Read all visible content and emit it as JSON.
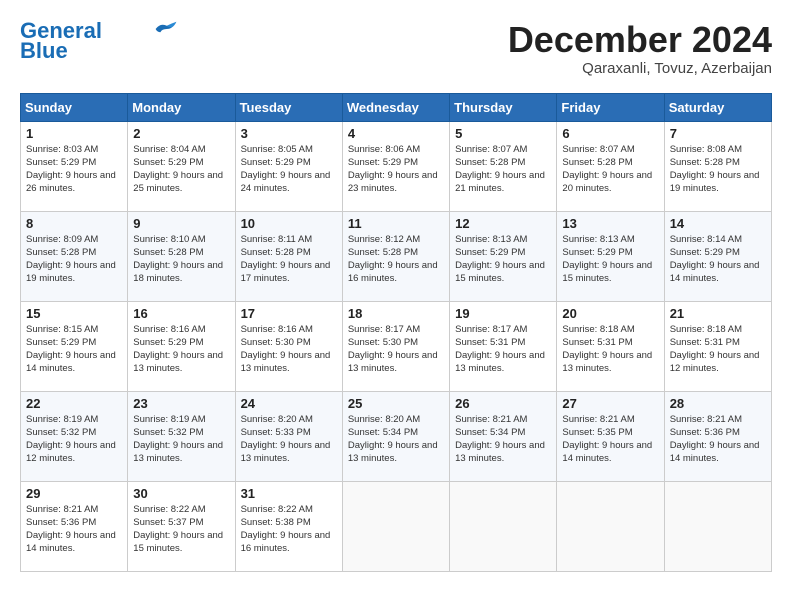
{
  "header": {
    "logo_line1": "General",
    "logo_line2": "Blue",
    "title": "December 2024",
    "subtitle": "Qaraxanli, Tovuz, Azerbaijan"
  },
  "calendar": {
    "headers": [
      "Sunday",
      "Monday",
      "Tuesday",
      "Wednesday",
      "Thursday",
      "Friday",
      "Saturday"
    ],
    "weeks": [
      [
        null,
        {
          "day": 2,
          "sunrise": "8:04 AM",
          "sunset": "5:29 PM",
          "daylight": "9 hours and 25 minutes."
        },
        {
          "day": 3,
          "sunrise": "8:05 AM",
          "sunset": "5:29 PM",
          "daylight": "9 hours and 24 minutes."
        },
        {
          "day": 4,
          "sunrise": "8:06 AM",
          "sunset": "5:29 PM",
          "daylight": "9 hours and 23 minutes."
        },
        {
          "day": 5,
          "sunrise": "8:07 AM",
          "sunset": "5:28 PM",
          "daylight": "9 hours and 21 minutes."
        },
        {
          "day": 6,
          "sunrise": "8:07 AM",
          "sunset": "5:28 PM",
          "daylight": "9 hours and 20 minutes."
        },
        {
          "day": 7,
          "sunrise": "8:08 AM",
          "sunset": "5:28 PM",
          "daylight": "9 hours and 19 minutes."
        }
      ],
      [
        {
          "day": 8,
          "sunrise": "8:09 AM",
          "sunset": "5:28 PM",
          "daylight": "9 hours and 19 minutes."
        },
        {
          "day": 9,
          "sunrise": "8:10 AM",
          "sunset": "5:28 PM",
          "daylight": "9 hours and 18 minutes."
        },
        {
          "day": 10,
          "sunrise": "8:11 AM",
          "sunset": "5:28 PM",
          "daylight": "9 hours and 17 minutes."
        },
        {
          "day": 11,
          "sunrise": "8:12 AM",
          "sunset": "5:28 PM",
          "daylight": "9 hours and 16 minutes."
        },
        {
          "day": 12,
          "sunrise": "8:13 AM",
          "sunset": "5:29 PM",
          "daylight": "9 hours and 15 minutes."
        },
        {
          "day": 13,
          "sunrise": "8:13 AM",
          "sunset": "5:29 PM",
          "daylight": "9 hours and 15 minutes."
        },
        {
          "day": 14,
          "sunrise": "8:14 AM",
          "sunset": "5:29 PM",
          "daylight": "9 hours and 14 minutes."
        }
      ],
      [
        {
          "day": 15,
          "sunrise": "8:15 AM",
          "sunset": "5:29 PM",
          "daylight": "9 hours and 14 minutes."
        },
        {
          "day": 16,
          "sunrise": "8:16 AM",
          "sunset": "5:29 PM",
          "daylight": "9 hours and 13 minutes."
        },
        {
          "day": 17,
          "sunrise": "8:16 AM",
          "sunset": "5:30 PM",
          "daylight": "9 hours and 13 minutes."
        },
        {
          "day": 18,
          "sunrise": "8:17 AM",
          "sunset": "5:30 PM",
          "daylight": "9 hours and 13 minutes."
        },
        {
          "day": 19,
          "sunrise": "8:17 AM",
          "sunset": "5:31 PM",
          "daylight": "9 hours and 13 minutes."
        },
        {
          "day": 20,
          "sunrise": "8:18 AM",
          "sunset": "5:31 PM",
          "daylight": "9 hours and 13 minutes."
        },
        {
          "day": 21,
          "sunrise": "8:18 AM",
          "sunset": "5:31 PM",
          "daylight": "9 hours and 12 minutes."
        }
      ],
      [
        {
          "day": 22,
          "sunrise": "8:19 AM",
          "sunset": "5:32 PM",
          "daylight": "9 hours and 12 minutes."
        },
        {
          "day": 23,
          "sunrise": "8:19 AM",
          "sunset": "5:32 PM",
          "daylight": "9 hours and 13 minutes."
        },
        {
          "day": 24,
          "sunrise": "8:20 AM",
          "sunset": "5:33 PM",
          "daylight": "9 hours and 13 minutes."
        },
        {
          "day": 25,
          "sunrise": "8:20 AM",
          "sunset": "5:34 PM",
          "daylight": "9 hours and 13 minutes."
        },
        {
          "day": 26,
          "sunrise": "8:21 AM",
          "sunset": "5:34 PM",
          "daylight": "9 hours and 13 minutes."
        },
        {
          "day": 27,
          "sunrise": "8:21 AM",
          "sunset": "5:35 PM",
          "daylight": "9 hours and 14 minutes."
        },
        {
          "day": 28,
          "sunrise": "8:21 AM",
          "sunset": "5:36 PM",
          "daylight": "9 hours and 14 minutes."
        }
      ],
      [
        {
          "day": 29,
          "sunrise": "8:21 AM",
          "sunset": "5:36 PM",
          "daylight": "9 hours and 14 minutes."
        },
        {
          "day": 30,
          "sunrise": "8:22 AM",
          "sunset": "5:37 PM",
          "daylight": "9 hours and 15 minutes."
        },
        {
          "day": 31,
          "sunrise": "8:22 AM",
          "sunset": "5:38 PM",
          "daylight": "9 hours and 16 minutes."
        },
        null,
        null,
        null,
        null
      ]
    ],
    "week0_day1": {
      "day": 1,
      "sunrise": "8:03 AM",
      "sunset": "5:29 PM",
      "daylight": "9 hours and 26 minutes."
    }
  },
  "labels": {
    "sunrise": "Sunrise:",
    "sunset": "Sunset:",
    "daylight": "Daylight:"
  }
}
